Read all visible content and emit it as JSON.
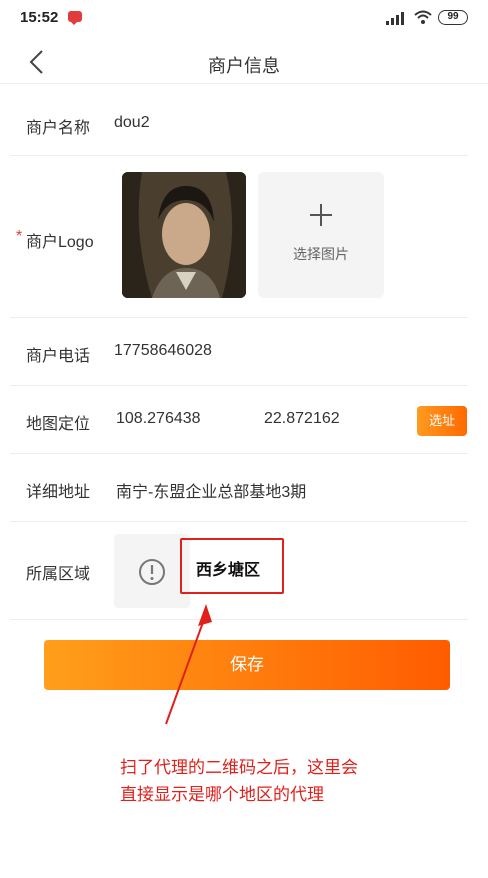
{
  "status_bar": {
    "time": "15:52",
    "battery": "99"
  },
  "nav": {
    "title": "商户信息"
  },
  "fields": {
    "name": {
      "label": "商户名称",
      "value": "dou2"
    },
    "logo": {
      "required_mark": "*",
      "label": "商户Logo",
      "add_image_label": "选择图片"
    },
    "phone": {
      "label": "商户电话",
      "value": "17758646028"
    },
    "map": {
      "label": "地图定位",
      "longitude": "108.276438",
      "latitude": "22.872162",
      "select_label": "选址"
    },
    "address": {
      "label": "详细地址",
      "value": "南宁-东盟企业总部基地3期"
    },
    "region": {
      "label": "所属区域",
      "value": "西乡塘区"
    }
  },
  "save_label": "保存",
  "annotation": {
    "line1": "扫了代理的二维码之后，这里会",
    "line2": "直接显示是哪个地区的代理"
  },
  "colors": {
    "accent_start": "#ff9f1a",
    "accent_end": "#ff5c00",
    "annotation": "#e0201b"
  }
}
